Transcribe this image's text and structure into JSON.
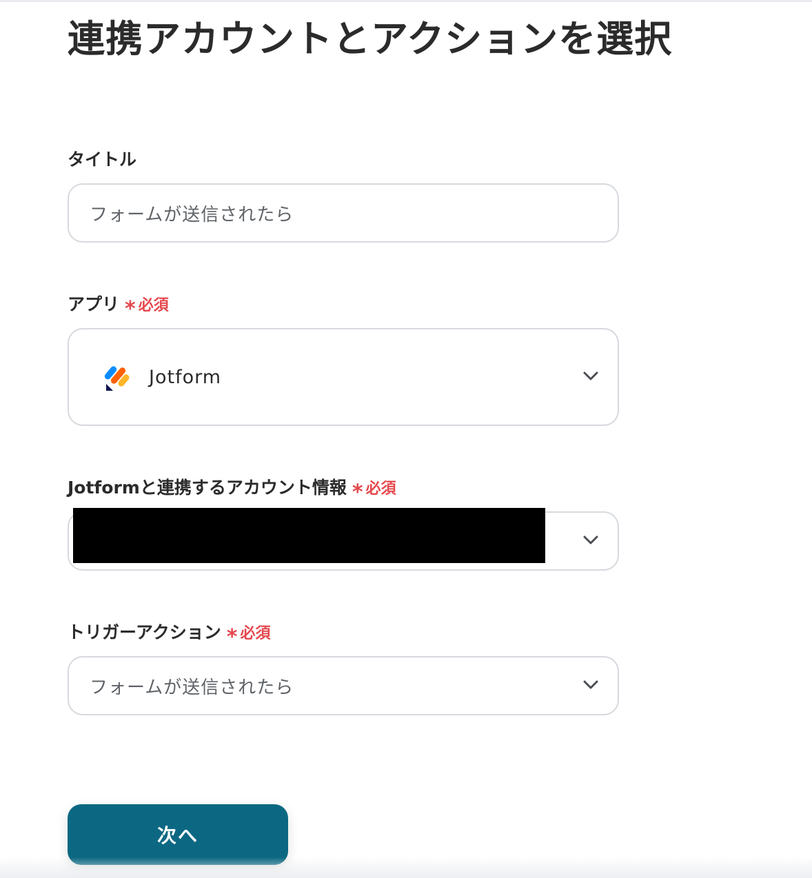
{
  "page": {
    "title": "連携アカウントとアクションを選択"
  },
  "form": {
    "title_field": {
      "label": "タイトル",
      "value": "フォームが送信されたら"
    },
    "app_field": {
      "label": "アプリ",
      "required_mark": "*",
      "required_text": "必須",
      "selected_app": "Jotform",
      "app_icon": "jotform-logo-icon"
    },
    "account_field": {
      "label": "Jotformと連携するアカウント情報",
      "required_mark": "*",
      "required_text": "必須",
      "value": ""
    },
    "trigger_field": {
      "label": "トリガーアクション",
      "required_mark": "*",
      "required_text": "必須",
      "value": "フォームが送信されたら"
    }
  },
  "actions": {
    "next_label": "次へ"
  },
  "colors": {
    "required": "#e5484d",
    "primary_button": "#0c6882",
    "border": "#d6d9de"
  }
}
